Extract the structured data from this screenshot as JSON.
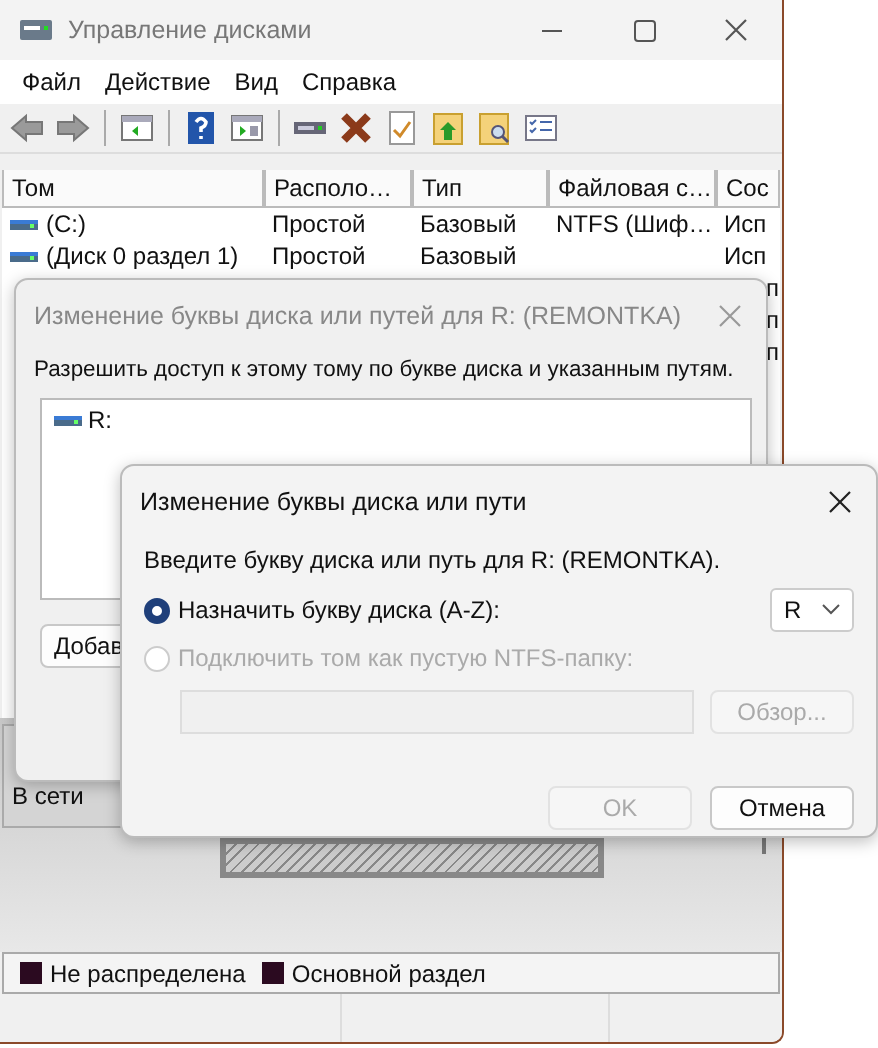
{
  "window": {
    "title": "Управление дисками"
  },
  "menu": [
    "Файл",
    "Действие",
    "Вид",
    "Справка"
  ],
  "table": {
    "columns": [
      "Том",
      "Располо…",
      "Тип",
      "Файловая с…",
      "Сос"
    ],
    "rows": [
      {
        "volume": "(C:)",
        "layout": "Простой",
        "type": "Базовый",
        "file_system": "NTFS (Шиф…",
        "column_5": "Исп"
      },
      {
        "volume": "(Диск 0 раздел 1)",
        "layout": "Простой",
        "type": "Базовый",
        "column_5": "Исп"
      }
    ],
    "partial_rows": [
      {
        "column_5": "п"
      },
      {
        "column_5": "п"
      },
      {
        "column_5": "п"
      }
    ]
  },
  "disk_panel": {
    "status": "В сети"
  },
  "legend": [
    {
      "label": "Не распределена",
      "color": "#2b0a20"
    },
    {
      "label": "Основной раздел",
      "color": "#2b0a20"
    }
  ],
  "dialog_paths": {
    "title": "Изменение буквы диска или путей для R: (REMONTKA)",
    "active": false,
    "description": "Разрешить доступ к этому тому по букве диска и указанным путям.",
    "paths": [
      {
        "label": "R:"
      }
    ],
    "buttons": [
      "Добав"
    ]
  },
  "dialog_letter": {
    "title": "Изменение буквы диска или пути",
    "active": true,
    "description": "Введите букву диска или путь для R: (REMONTKA).",
    "options": [
      {
        "label": "Назначить букву диска (A-Z):",
        "selected": true,
        "disabled": false
      },
      {
        "label": "Подключить том как пустую NTFS-папку:",
        "selected": false,
        "disabled": true
      }
    ],
    "drive_letter": "R",
    "folder_field": {
      "disabled": true
    },
    "browse": {
      "label": "Обзор...",
      "disabled": true
    },
    "buttons": [
      {
        "label": "OK",
        "disabled": true
      },
      {
        "label": "Отмена",
        "disabled": false
      }
    ]
  }
}
